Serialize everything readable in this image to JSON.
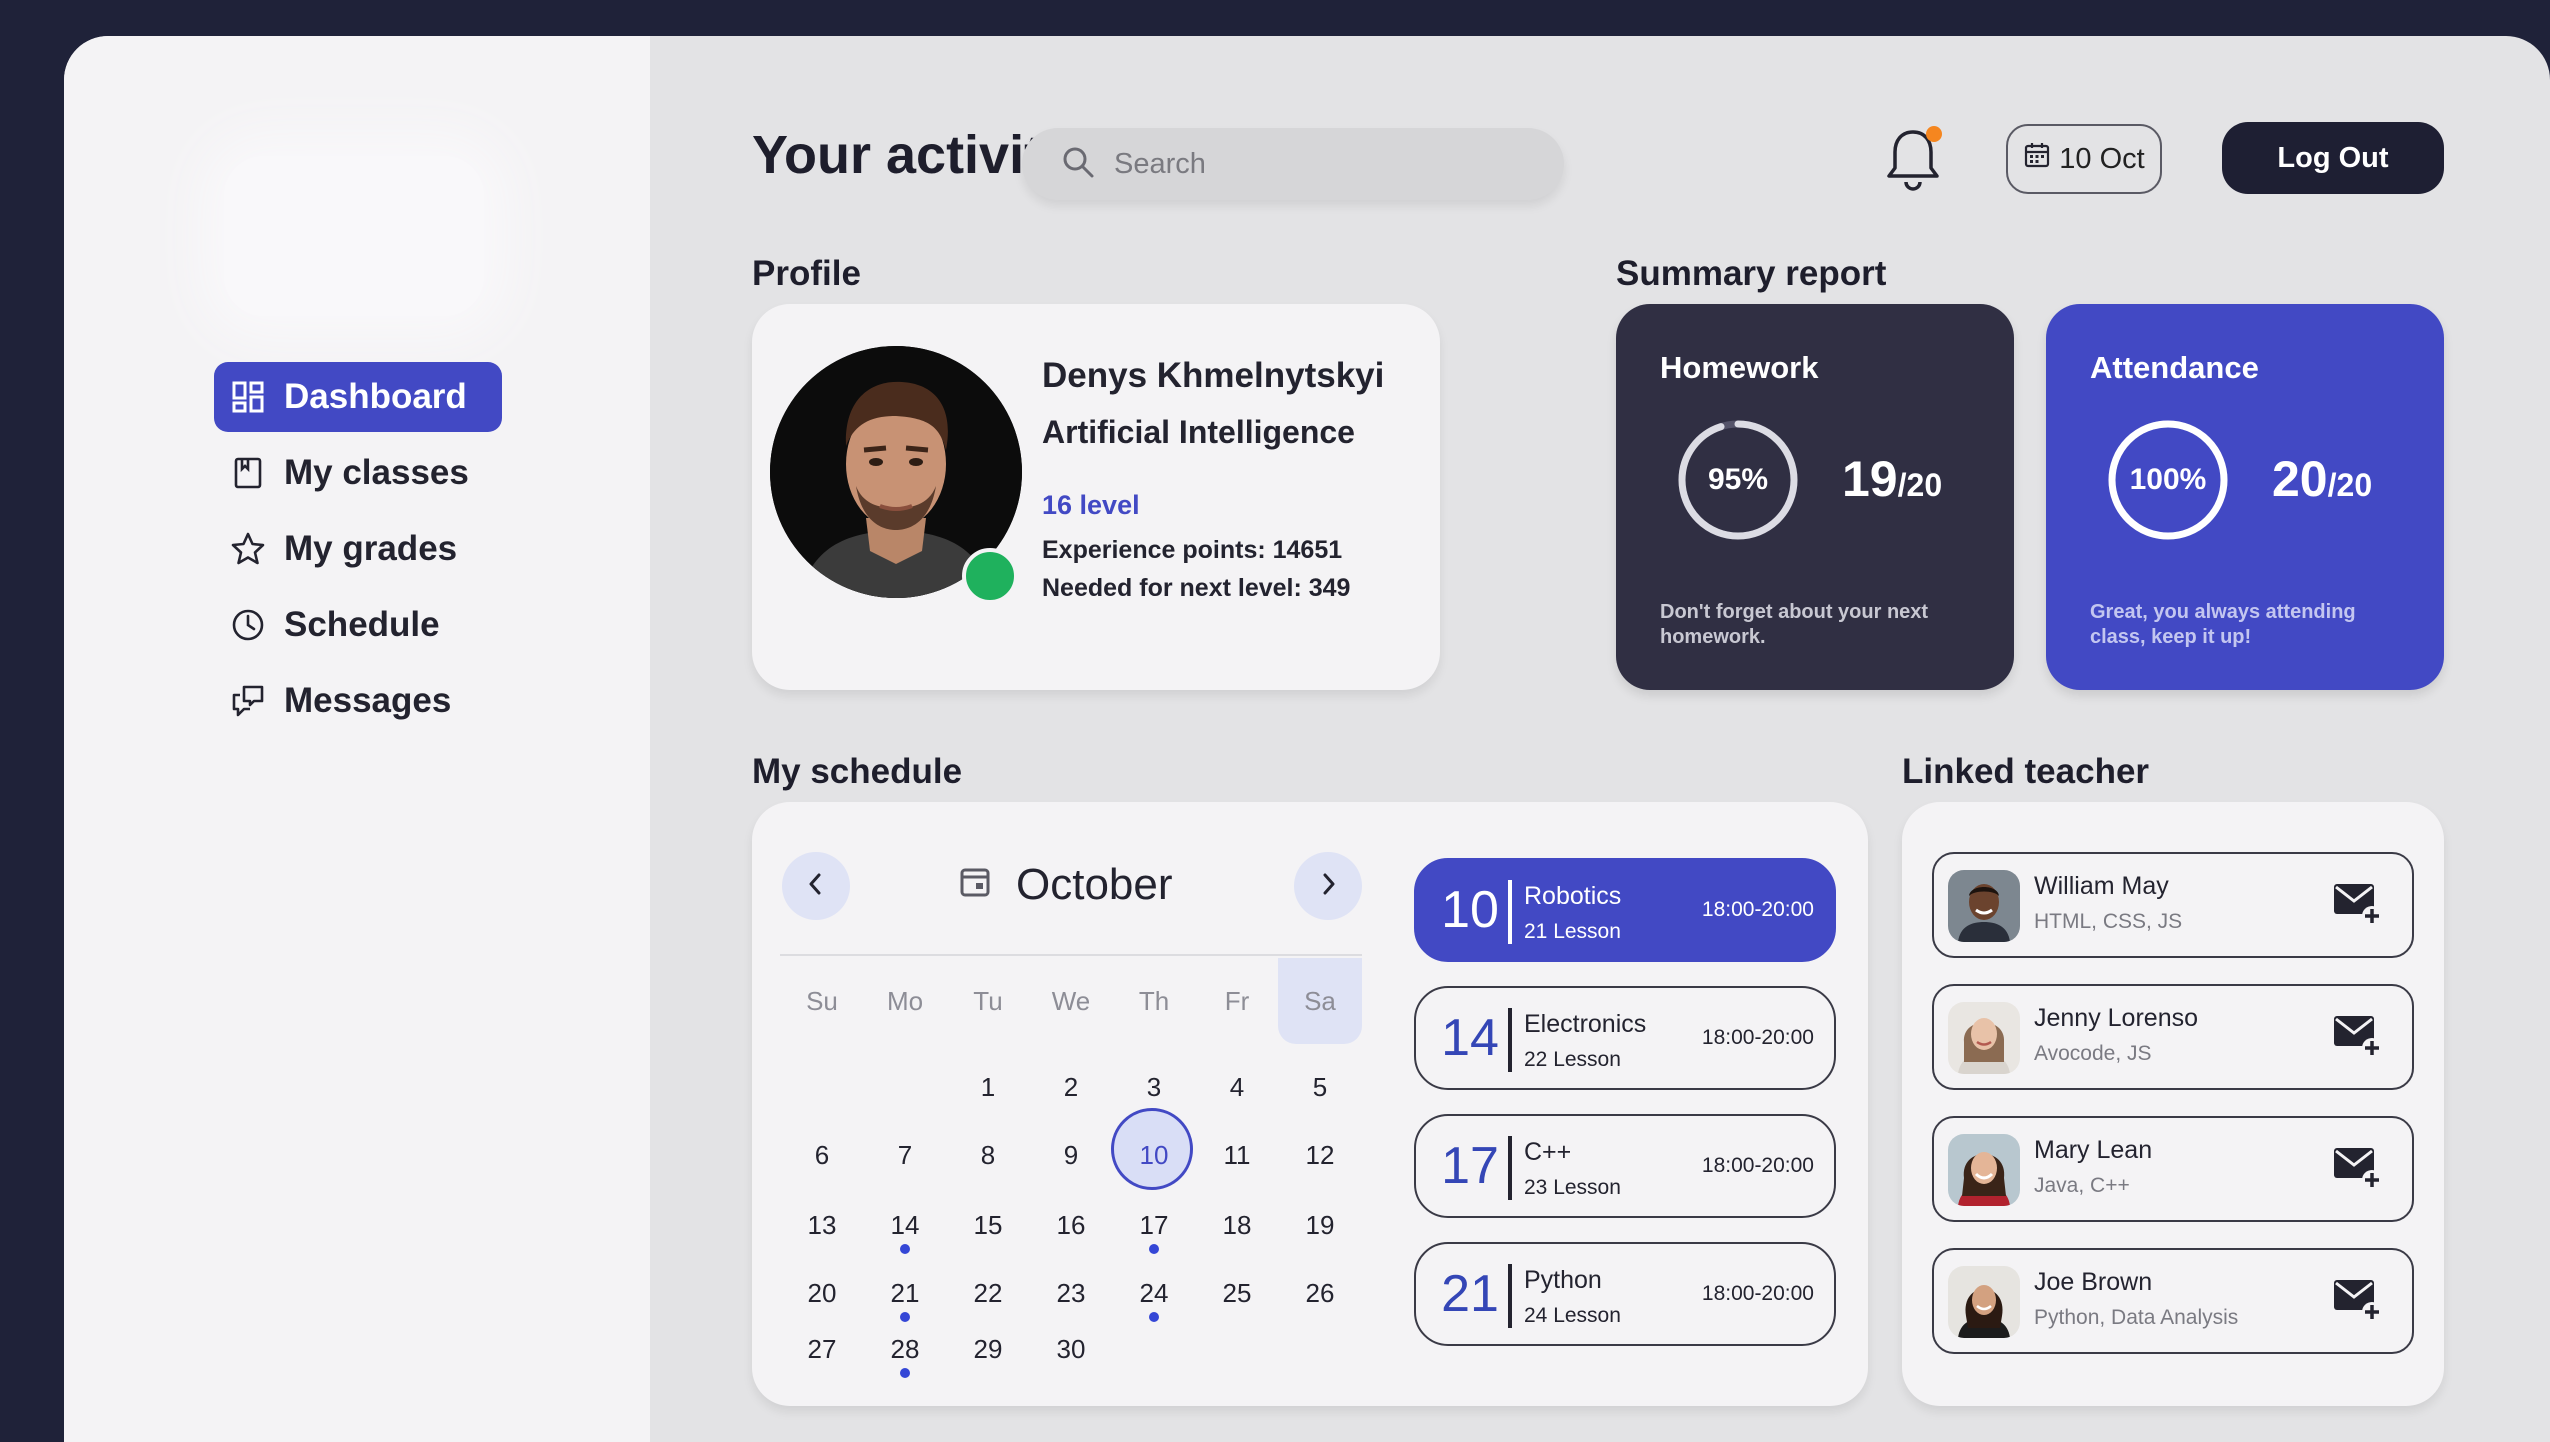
{
  "header": {
    "title": "Your activity",
    "search_placeholder": "Search",
    "date_label": "10 Oct",
    "logout_label": "Log Out"
  },
  "sidebar": {
    "items": [
      {
        "label": "Dashboard",
        "icon": "dashboard-icon",
        "active": true
      },
      {
        "label": "My classes",
        "icon": "notebook-icon",
        "active": false
      },
      {
        "label": "My grades",
        "icon": "star-icon",
        "active": false
      },
      {
        "label": "Schedule",
        "icon": "clock-icon",
        "active": false
      },
      {
        "label": "Messages",
        "icon": "chat-icon",
        "active": false
      }
    ]
  },
  "profile": {
    "section_title": "Profile",
    "name": "Denys Khmelnytskyi",
    "field": "Artificial Intelligence",
    "level": "16 level",
    "experience": "Experience points: 14651",
    "next_level": "Needed for next level: 349",
    "status": "online"
  },
  "summary": {
    "section_title": "Summary report",
    "homework": {
      "title": "Homework",
      "percent_label": "95%",
      "percent_value": 95,
      "count": "19",
      "total": "/20",
      "note": "Don't forget about your next homework."
    },
    "attendance": {
      "title": "Attendance",
      "percent_label": "100%",
      "percent_value": 100,
      "count": "20",
      "total": "/20",
      "note": "Great, you always attending class, keep it up!"
    }
  },
  "schedule": {
    "section_title": "My schedule",
    "month": "October",
    "weekdays": [
      "Su",
      "Mo",
      "Tu",
      "We",
      "Th",
      "Fr",
      "Sa"
    ],
    "days": [
      [
        "",
        "",
        "1",
        "2",
        "3",
        "4",
        "5"
      ],
      [
        "6",
        "7",
        "8",
        "9",
        "10",
        "11",
        "12"
      ],
      [
        "13",
        "14",
        "15",
        "16",
        "17",
        "18",
        "19"
      ],
      [
        "20",
        "21",
        "22",
        "23",
        "24",
        "25",
        "26"
      ],
      [
        "27",
        "28",
        "29",
        "30",
        "",
        "",
        ""
      ]
    ],
    "today": "10",
    "event_days": [
      "14",
      "17",
      "21",
      "24",
      "28"
    ],
    "lessons": [
      {
        "day": "10",
        "name": "Robotics",
        "lesson": "21 Lesson",
        "time": "18:00-20:00",
        "active": true
      },
      {
        "day": "14",
        "name": "Electronics",
        "lesson": "22 Lesson",
        "time": "18:00-20:00",
        "active": false
      },
      {
        "day": "17",
        "name": "C++",
        "lesson": "23 Lesson",
        "time": "18:00-20:00",
        "active": false
      },
      {
        "day": "21",
        "name": "Python",
        "lesson": "24 Lesson",
        "time": "18:00-20:00",
        "active": false
      }
    ]
  },
  "teachers": {
    "section_title": "Linked teacher",
    "items": [
      {
        "name": "William May",
        "skills": "HTML, CSS, JS"
      },
      {
        "name": "Jenny Lorenso",
        "skills": "Avocode, JS"
      },
      {
        "name": "Mary Lean",
        "skills": "Java, C++"
      },
      {
        "name": "Joe Brown",
        "skills": "Python, Data Analysis"
      }
    ]
  },
  "colors": {
    "accent": "#4249c4",
    "dark_card": "#302f43",
    "notification_dot": "#f5861f",
    "online": "#1fb15d"
  }
}
